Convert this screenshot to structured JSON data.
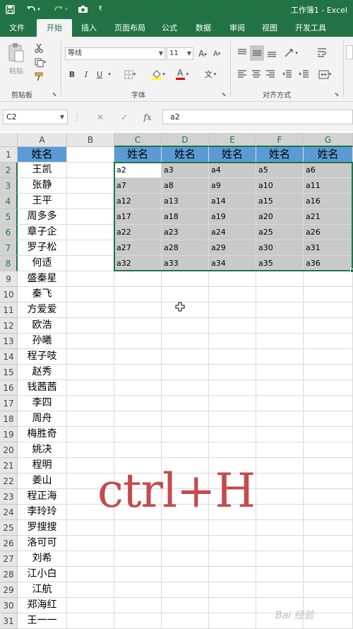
{
  "title": "工作簿1 - Excel",
  "tabs": [
    "文件",
    "开始",
    "插入",
    "页面布局",
    "公式",
    "数据",
    "审阅",
    "视图",
    "开发工具"
  ],
  "active_tab": "开始",
  "ribbon": {
    "clipboard": {
      "paste": "粘贴",
      "group": "剪贴板"
    },
    "font": {
      "name": "等线",
      "size": "11",
      "bold": "B",
      "italic": "I",
      "underline": "U",
      "group": "字体",
      "grow": "A",
      "shrink": "A",
      "color": "A",
      "phonetic": "文"
    },
    "alignment": {
      "group": "对齐方式"
    }
  },
  "name_box": "C2",
  "formula_value": "a2",
  "columns": [
    "A",
    "B",
    "C",
    "D",
    "E",
    "F",
    "G"
  ],
  "rows": [
    "1",
    "2",
    "3",
    "4",
    "5",
    "6",
    "7",
    "8",
    "9",
    "10",
    "11",
    "12",
    "13",
    "14",
    "15",
    "16",
    "17",
    "18",
    "19",
    "20",
    "21",
    "22",
    "23",
    "24",
    "25",
    "26",
    "27",
    "28",
    "29",
    "30",
    "31"
  ],
  "column_a": [
    "姓名",
    "王凯",
    "张静",
    "王平",
    "周多多",
    "章子企",
    "罗子松",
    "何适",
    "盛秦星",
    "秦飞",
    "方爱爱",
    "欧浩",
    "孙曦",
    "程子吱",
    "赵秀",
    "钱茜茜",
    "李四",
    "周舟",
    "梅胜奇",
    "姚决",
    "程明",
    "姜山",
    "程正海",
    "李玲玲",
    "罗搜搜",
    "洛可可",
    "刘希",
    "江小白",
    "江航",
    "郑海红",
    "王一一"
  ],
  "table_header": [
    "姓名",
    "姓名",
    "姓名",
    "姓名",
    "姓名"
  ],
  "table_rows": [
    [
      "a2",
      "a3",
      "a4",
      "a5",
      "a6"
    ],
    [
      "a7",
      "a8",
      "a9",
      "a10",
      "a11"
    ],
    [
      "a12",
      "a13",
      "a14",
      "a15",
      "a16"
    ],
    [
      "a17",
      "a18",
      "a19",
      "a20",
      "a21"
    ],
    [
      "a22",
      "a23",
      "a24",
      "a25",
      "a26"
    ],
    [
      "a27",
      "a28",
      "a29",
      "a30",
      "a31"
    ],
    [
      "a32",
      "a33",
      "a34",
      "a35",
      "a36"
    ]
  ],
  "overlay_text": "ctrl+H",
  "watermark": "Bai 经验",
  "colors": {
    "excel_green": "#217346",
    "header_fill": "#5b9bd5",
    "selection_fill": "#c9c9c9",
    "overlay_red": "#c54a4d"
  }
}
